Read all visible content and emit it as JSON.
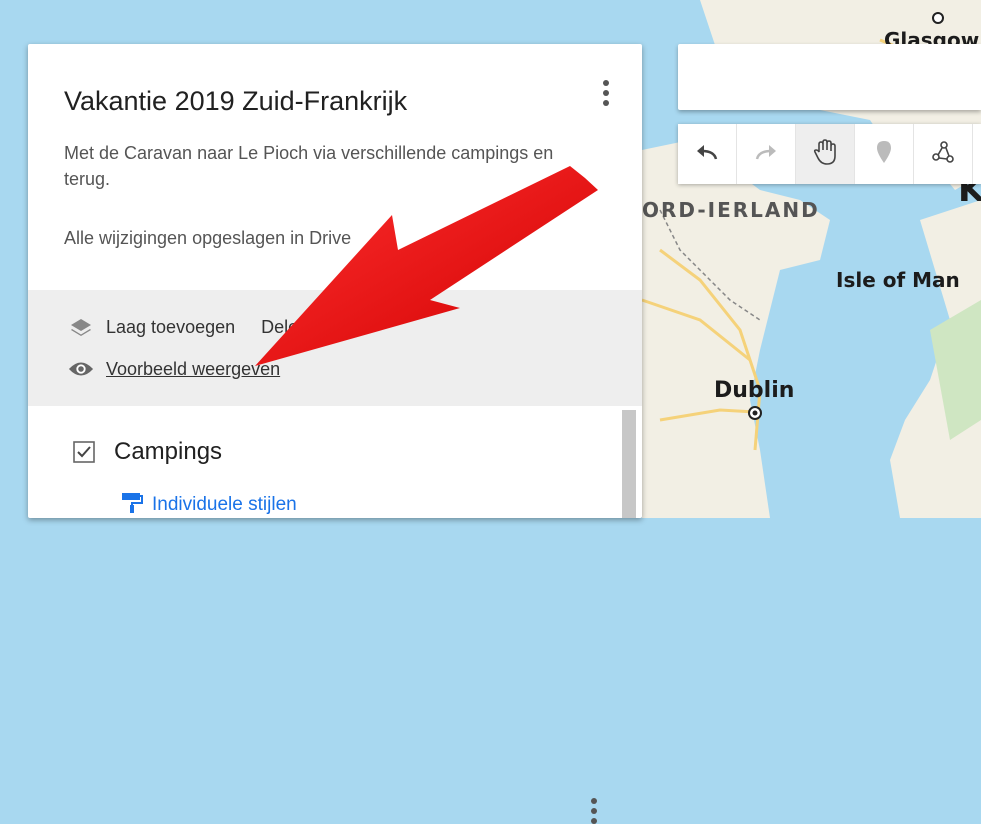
{
  "map": {
    "labels": {
      "glasgow": "Glasgow",
      "northern_ireland": "ORD-IERLAND",
      "isle_of_man": "Isle of Man",
      "dublin": "Dublin",
      "k": "K"
    },
    "colors": {
      "sea": "#a8d8f0",
      "land": "#f2efe4",
      "green": "#cfe6c2"
    }
  },
  "panel": {
    "title": "Vakantie 2019 Zuid-Frankrijk",
    "description": "Met de Caravan naar Le Pioch via verschillende campings en terug.",
    "save_status": "Alle wijzigingen opgeslagen in Drive",
    "actions": {
      "add_layer": "Laag toevoegen",
      "share": "Delen",
      "preview": "Voorbeeld weergeven"
    },
    "layer": {
      "name": "Campings",
      "checked": true,
      "style_link": "Individuele stijlen"
    }
  },
  "toolbar": {
    "buttons": [
      "undo-icon",
      "redo-icon",
      "hand-icon",
      "marker-icon",
      "draw-line-icon"
    ],
    "active": "hand-icon"
  },
  "search": {
    "placeholder": ""
  },
  "annotation": {
    "arrow_color": "#e00000"
  }
}
